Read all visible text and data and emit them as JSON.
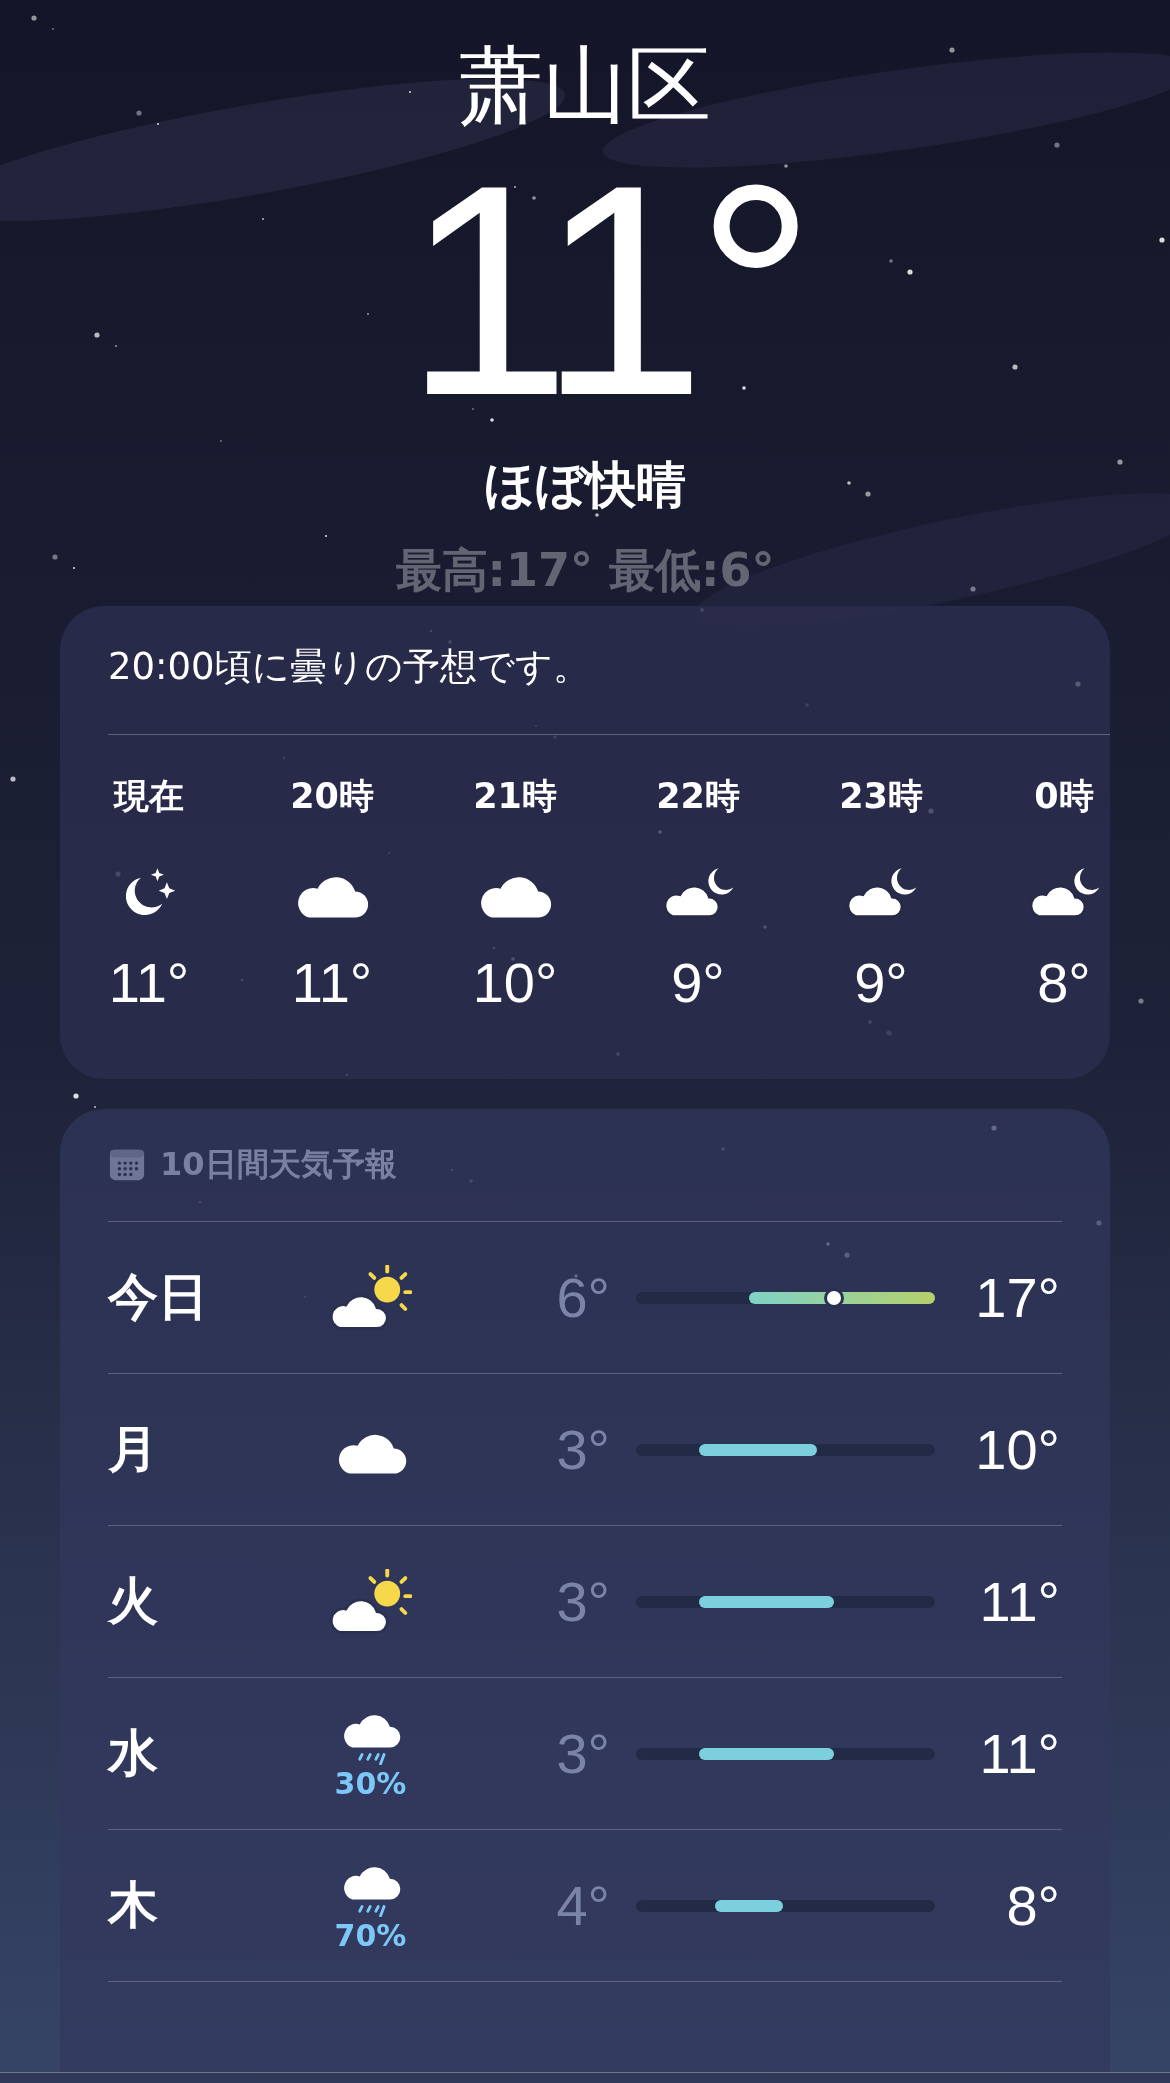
{
  "location": "萧山区",
  "temperature": "11°",
  "condition": "ほぼ快晴",
  "high_low": "最高:17°  最低:6°",
  "hourly": {
    "summary": "20:00頃に曇りの予想です。",
    "hours": [
      {
        "label": "現在",
        "kind": "moon-stars",
        "temp": "11°"
      },
      {
        "label": "20時",
        "kind": "cloud",
        "temp": "11°"
      },
      {
        "label": "21時",
        "kind": "cloud",
        "temp": "10°"
      },
      {
        "label": "22時",
        "kind": "cloud-moon",
        "temp": "9°"
      },
      {
        "label": "23時",
        "kind": "cloud-moon",
        "temp": "9°"
      },
      {
        "label": "0時",
        "kind": "cloud-moon",
        "temp": "8°"
      }
    ]
  },
  "daily": {
    "title": "10日間天気予報",
    "days": [
      {
        "day": "今日",
        "kind": "cloud-sun",
        "low": "6°",
        "high": "17°",
        "current": true
      },
      {
        "day": "月",
        "kind": "cloud",
        "low": "3°",
        "high": "10°",
        "current": false
      },
      {
        "day": "火",
        "kind": "cloud-sun",
        "low": "3°",
        "high": "11°",
        "current": false
      },
      {
        "day": "水",
        "kind": "cloud-rain",
        "rain": "30%",
        "low": "3°",
        "high": "11°",
        "current": false
      },
      {
        "day": "木",
        "kind": "cloud-rain",
        "rain": "70%",
        "low": "4°",
        "high": "8°",
        "current": false
      }
    ]
  }
}
